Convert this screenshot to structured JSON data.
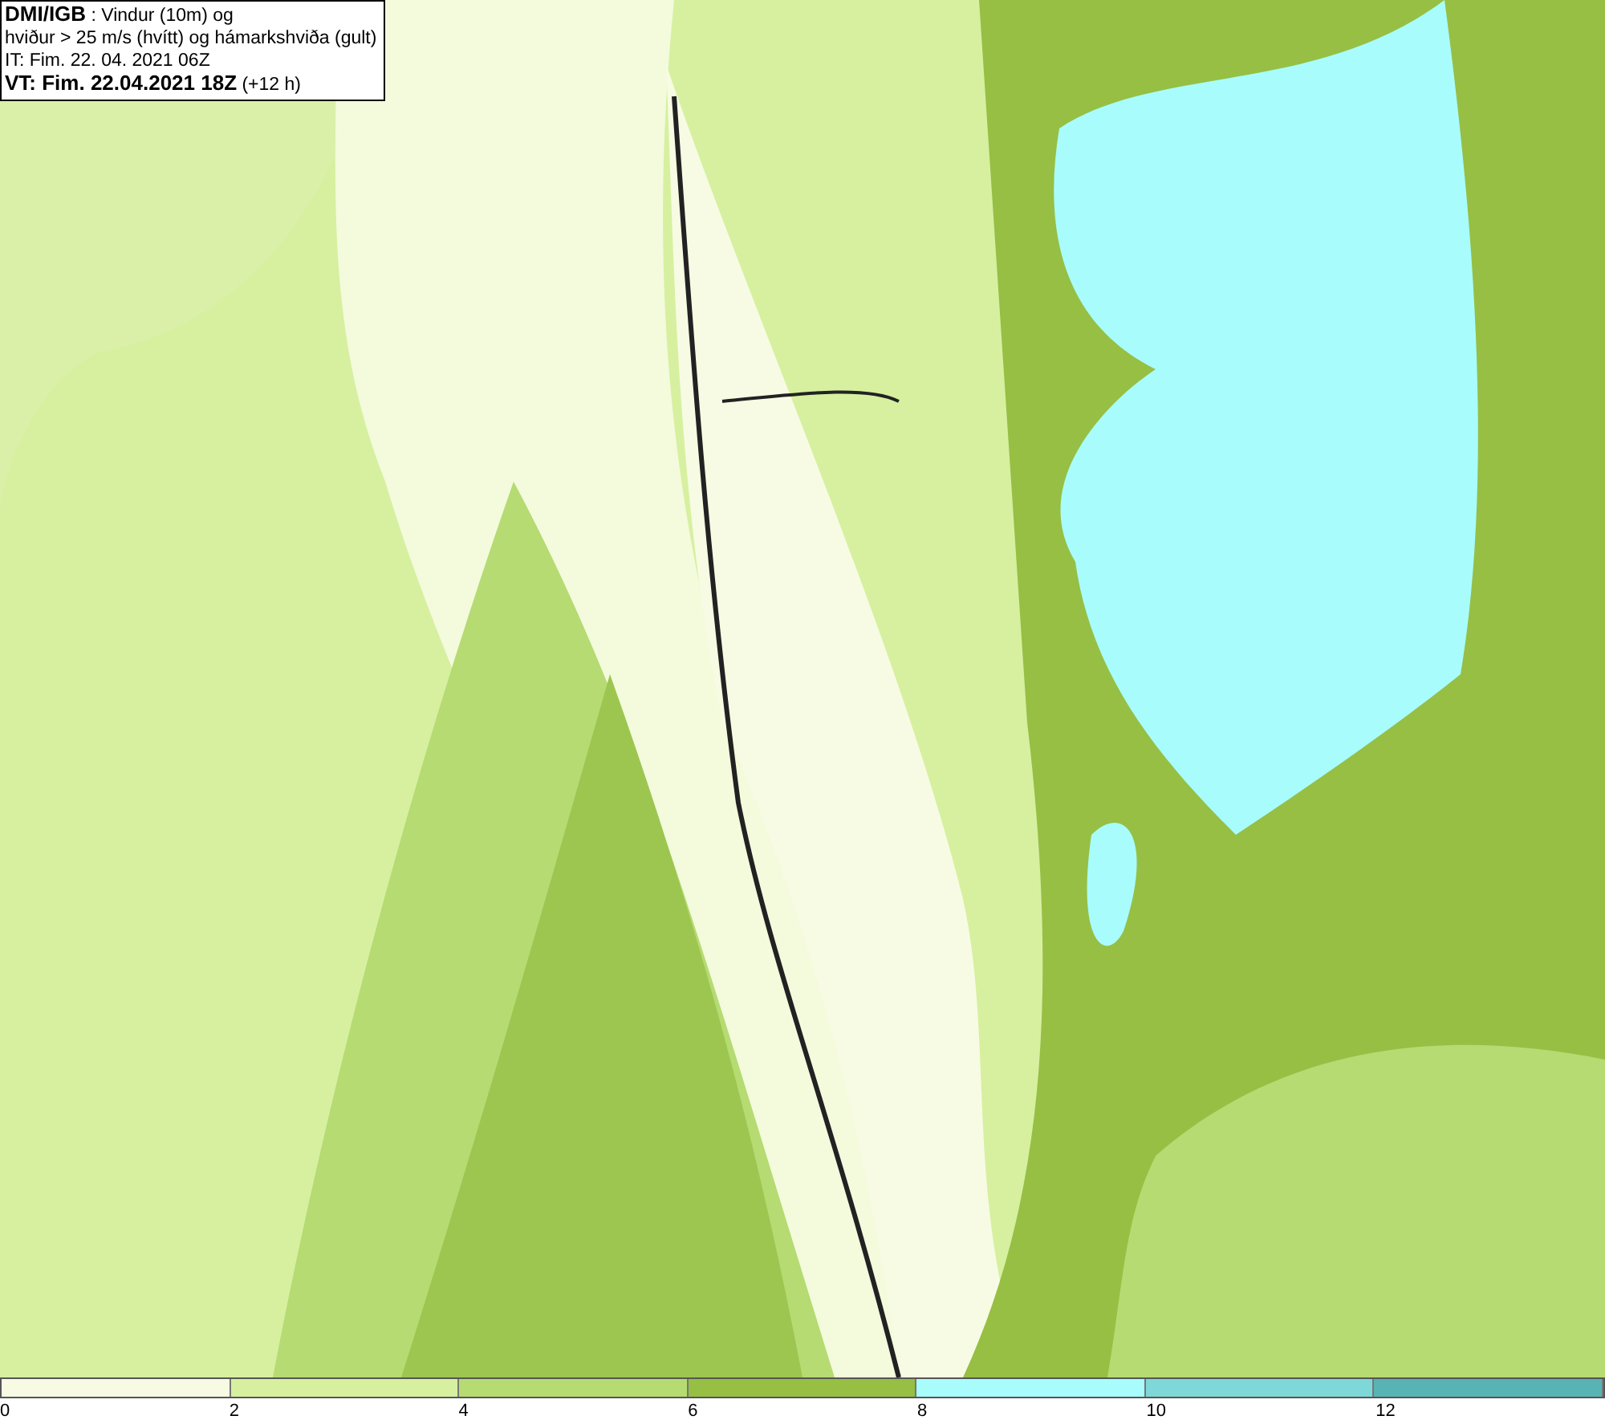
{
  "info_box": {
    "lines": [
      "**DMI/IGB** : Vindur (10m) og",
      "hviður > 25 m/s (hvítt) og hámarkshviða (gult)",
      "IT: Fim. 22. 04. 2021 06Z",
      "**VT: Fim. 22.04.2021 18Z** (+12 h)"
    ]
  },
  "legend": {
    "bins": [
      {
        "color": "#f7fbe3",
        "label": "0"
      },
      {
        "color": "#d6f0a0",
        "label": "2"
      },
      {
        "color": "#b5db72",
        "label": "4"
      },
      {
        "color": "#96bf44",
        "label": "6"
      },
      {
        "color": "#a8fcfc",
        "label": "8"
      },
      {
        "color": "#7fd8d8",
        "label": "10"
      },
      {
        "color": "#58b4b4",
        "label": "12"
      }
    ]
  }
}
